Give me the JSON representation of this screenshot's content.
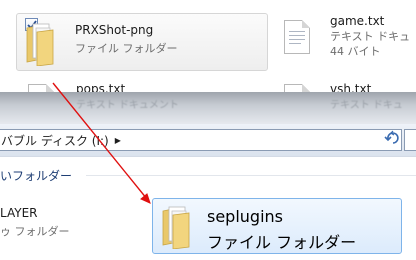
{
  "top_pane": {
    "selected_item": {
      "name": "PRXShot-png",
      "type": "ファイル フォルダー"
    },
    "game_txt": {
      "name": "game.txt",
      "type": "テキスト ドキュ",
      "size": "44 バイト"
    },
    "pops_txt": {
      "name": "pops.txt",
      "type": "テキスト ドキュメント"
    },
    "vsh_txt": {
      "name": "vsh.txt",
      "type": "テキスト ドキュ"
    }
  },
  "address_bar": {
    "path": "バブル ディスク (I:)",
    "arrow": "▶"
  },
  "section": {
    "label": "いフォルダー"
  },
  "bottom_pane": {
    "left_item": {
      "name": "LAYER",
      "type": "ゥ フォルダー"
    },
    "target_item": {
      "name": "seplugins",
      "type": "ファイル フォルダー"
    }
  },
  "colors": {
    "arrow": "#e01010",
    "hover_border": "#7eb4ea",
    "folder": "#f0d27a"
  }
}
